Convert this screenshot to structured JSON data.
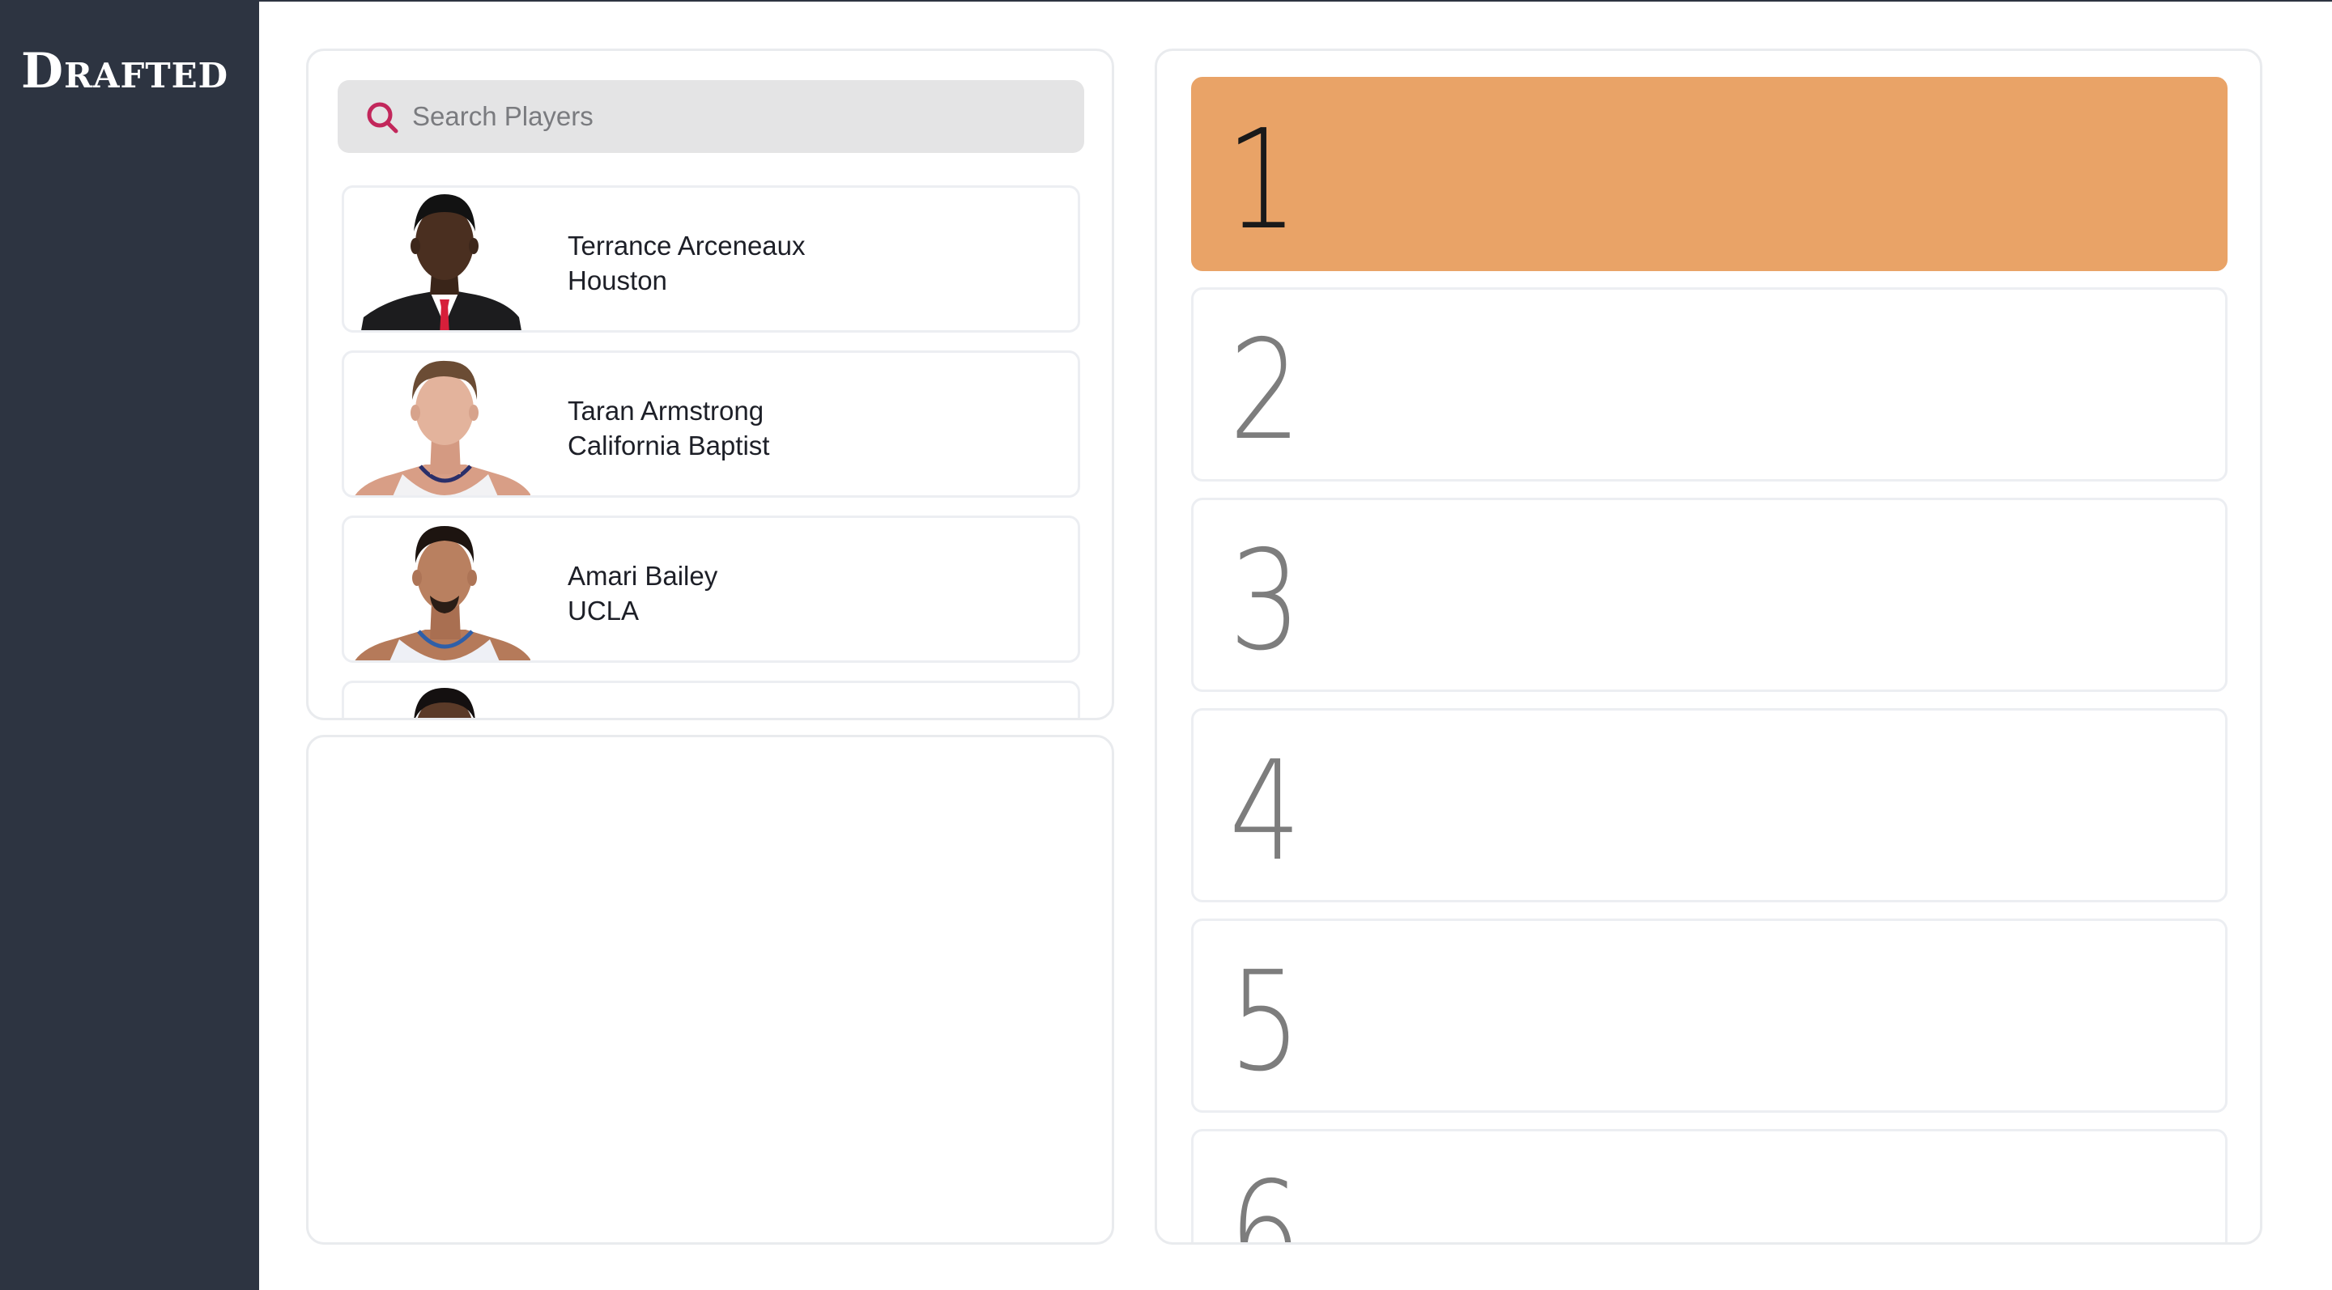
{
  "app": {
    "logo": "Drafted"
  },
  "colors": {
    "sidebar": "#2d3441",
    "active_pick": "#e9a367",
    "search_icon": "#c2275b",
    "search_bg": "#e4e4e5"
  },
  "search": {
    "placeholder": "Search Players",
    "value": "",
    "icon": "search-icon"
  },
  "players": [
    {
      "name": "Terrance Arceneaux",
      "school": "Houston",
      "photo": "player-headshot-suit"
    },
    {
      "name": "Taran Armstrong",
      "school": "California Baptist",
      "photo": "player-headshot-jersey"
    },
    {
      "name": "Amari Bailey",
      "school": "UCLA",
      "photo": "player-headshot-jersey"
    },
    {
      "name": "",
      "school": "",
      "photo": "player-headshot-partial"
    }
  ],
  "picks": [
    {
      "number": "1",
      "active": true
    },
    {
      "number": "2",
      "active": false
    },
    {
      "number": "3",
      "active": false
    },
    {
      "number": "4",
      "active": false
    },
    {
      "number": "5",
      "active": false
    },
    {
      "number": "6",
      "active": false
    }
  ]
}
